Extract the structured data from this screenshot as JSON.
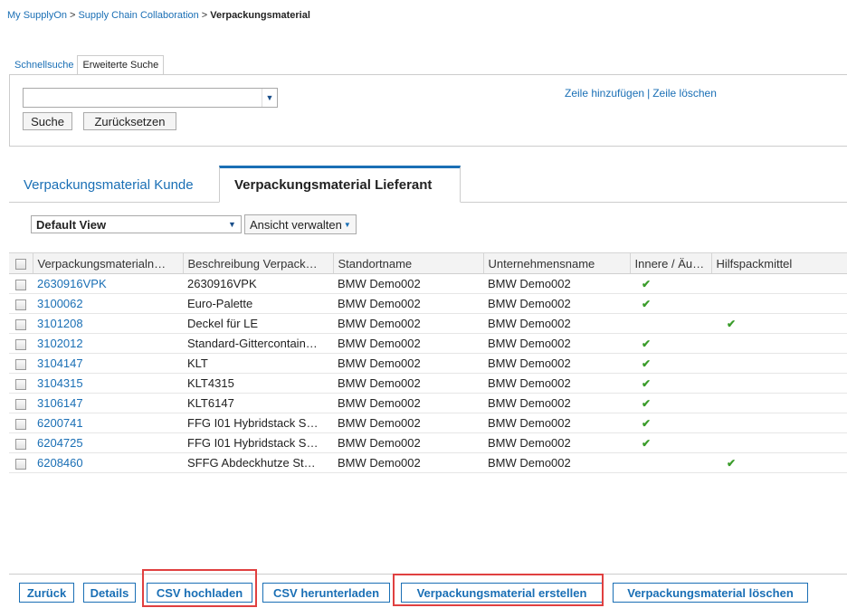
{
  "breadcrumb": {
    "items": [
      "My SupplyOn",
      "Supply Chain Collaboration"
    ],
    "separator": ">",
    "current": "Verpackungsmaterial"
  },
  "search": {
    "tabs": [
      "Schnellsuche",
      "Erweiterte Suche"
    ],
    "active_tab": "Erweiterte Suche",
    "field_value": "",
    "search_label": "Suche",
    "reset_label": "Zurücksetzen",
    "add_row_label": "Zeile hinzufügen",
    "row_separator": "|",
    "delete_row_label": "Zeile löschen"
  },
  "main_tabs": {
    "customer": "Verpackungsmaterial Kunde",
    "supplier": "Verpackungsmaterial Lieferant",
    "active": "Verpackungsmaterial Lieferant"
  },
  "view": {
    "selected": "Default View",
    "manage_label": "Ansicht verwalten"
  },
  "table": {
    "columns": [
      "Verpackungsmaterialn…",
      "Beschreibung Verpack…",
      "Standortname",
      "Unternehmensname",
      "Innere / Äu…",
      "Hilfspackmittel"
    ],
    "rows": [
      {
        "id": "2630916VPK",
        "desc": "2630916VPK",
        "site": "BMW Demo002",
        "company": "BMW Demo002",
        "inner": true,
        "aux": false
      },
      {
        "id": "3100062",
        "desc": "Euro-Palette",
        "site": "BMW Demo002",
        "company": "BMW Demo002",
        "inner": true,
        "aux": false
      },
      {
        "id": "3101208",
        "desc": "Deckel für LE",
        "site": "BMW Demo002",
        "company": "BMW Demo002",
        "inner": false,
        "aux": true
      },
      {
        "id": "3102012",
        "desc": "Standard-Gittercontain…",
        "site": "BMW Demo002",
        "company": "BMW Demo002",
        "inner": true,
        "aux": false
      },
      {
        "id": "3104147",
        "desc": "KLT",
        "site": "BMW Demo002",
        "company": "BMW Demo002",
        "inner": true,
        "aux": false
      },
      {
        "id": "3104315",
        "desc": "KLT4315",
        "site": "BMW Demo002",
        "company": "BMW Demo002",
        "inner": true,
        "aux": false
      },
      {
        "id": "3106147",
        "desc": "KLT6147",
        "site": "BMW Demo002",
        "company": "BMW Demo002",
        "inner": true,
        "aux": false
      },
      {
        "id": "6200741",
        "desc": "FFG I01 Hybridstack S…",
        "site": "BMW Demo002",
        "company": "BMW Demo002",
        "inner": true,
        "aux": false
      },
      {
        "id": "6204725",
        "desc": "FFG I01 Hybridstack S…",
        "site": "BMW Demo002",
        "company": "BMW Demo002",
        "inner": true,
        "aux": false
      },
      {
        "id": "6208460",
        "desc": "SFFG Abdeckhutze St…",
        "site": "BMW Demo002",
        "company": "BMW Demo002",
        "inner": false,
        "aux": true
      }
    ]
  },
  "footer": {
    "back": "Zurück",
    "details": "Details",
    "csv_upload": "CSV hochladen",
    "csv_download": "CSV herunterladen",
    "create": "Verpackungsmaterial erstellen",
    "delete": "Verpackungsmaterial löschen"
  },
  "icons": {
    "dropdown": "chevron-down-icon",
    "check": "checkmark-icon"
  },
  "colors": {
    "link": "#1a6fb5",
    "check": "#3a9c2a",
    "highlight": "#e04040"
  }
}
